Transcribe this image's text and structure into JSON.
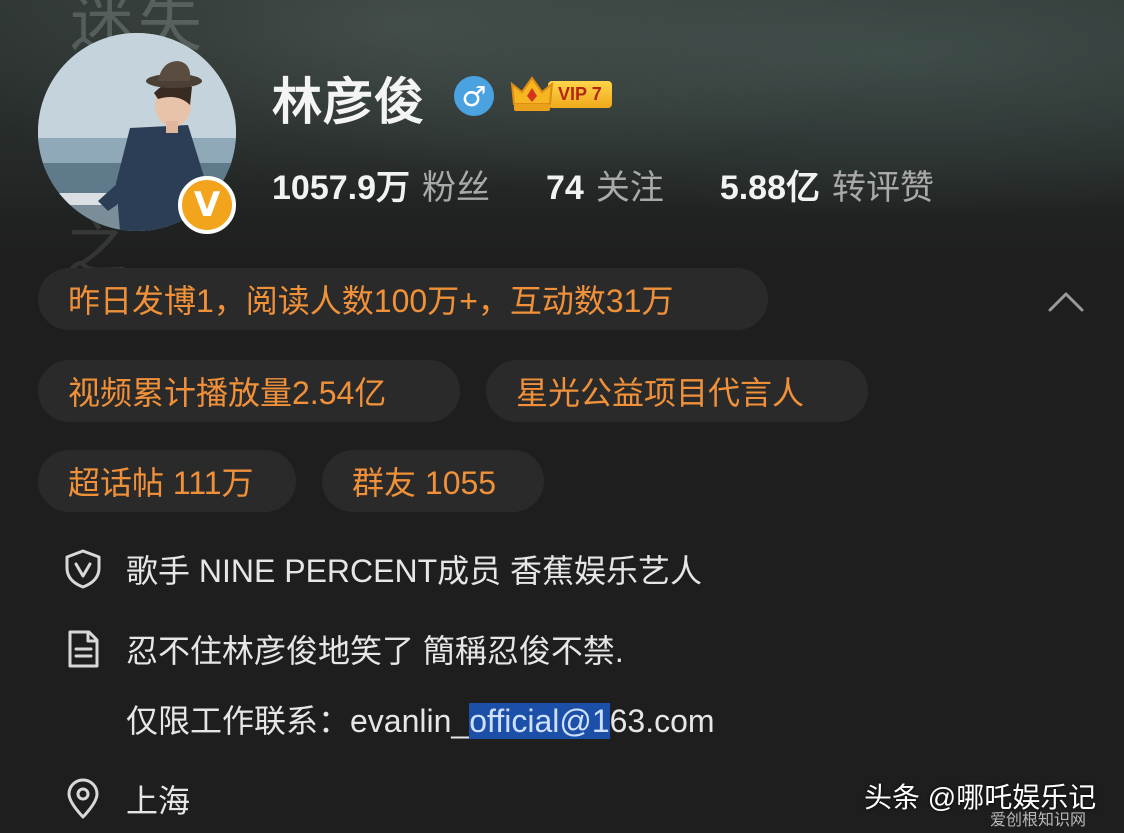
{
  "profile": {
    "name": "林彦俊",
    "vip_level": "VIP 7",
    "stats": [
      {
        "value": "1057.9万",
        "label": "粉丝"
      },
      {
        "value": "74",
        "label": "关注"
      },
      {
        "value": "5.88亿",
        "label": "转评赞"
      }
    ]
  },
  "banner_text": {
    "top": "迷失",
    "bottom": "之"
  },
  "pills": {
    "activity": "昨日发博1，阅读人数100万+，互动数31万",
    "video": "视频累计播放量2.54亿",
    "charity": "星光公益项目代言人",
    "supertopic": "超话帖 111万",
    "group": "群友 1055"
  },
  "info": {
    "verification": "歌手 NINE PERCENT成员 香蕉娱乐艺人",
    "bio_line1": "忍不住林彦俊地笑了 簡稱忍俊不禁.",
    "bio_line2_prefix": "仅限工作联系：evanlin_",
    "bio_line2_highlight": "official@1",
    "bio_line2_suffix": "63.com",
    "location": "上海"
  },
  "watermark": {
    "text": "头条 @哪吒娱乐记",
    "sub": "爱创根知识网"
  },
  "colors": {
    "accent_orange": "#f0913a",
    "verified_gold": "#f2a51c",
    "gender_blue": "#4aa3e0",
    "selection_blue": "#1b4fa8"
  },
  "icons": {
    "gender": "male-symbol-icon",
    "verified": "verified-v-icon",
    "vip": "crown-icon",
    "collapse": "chevron-up-icon",
    "verification": "shield-v-icon",
    "bio": "document-icon",
    "location": "location-pin-icon"
  }
}
